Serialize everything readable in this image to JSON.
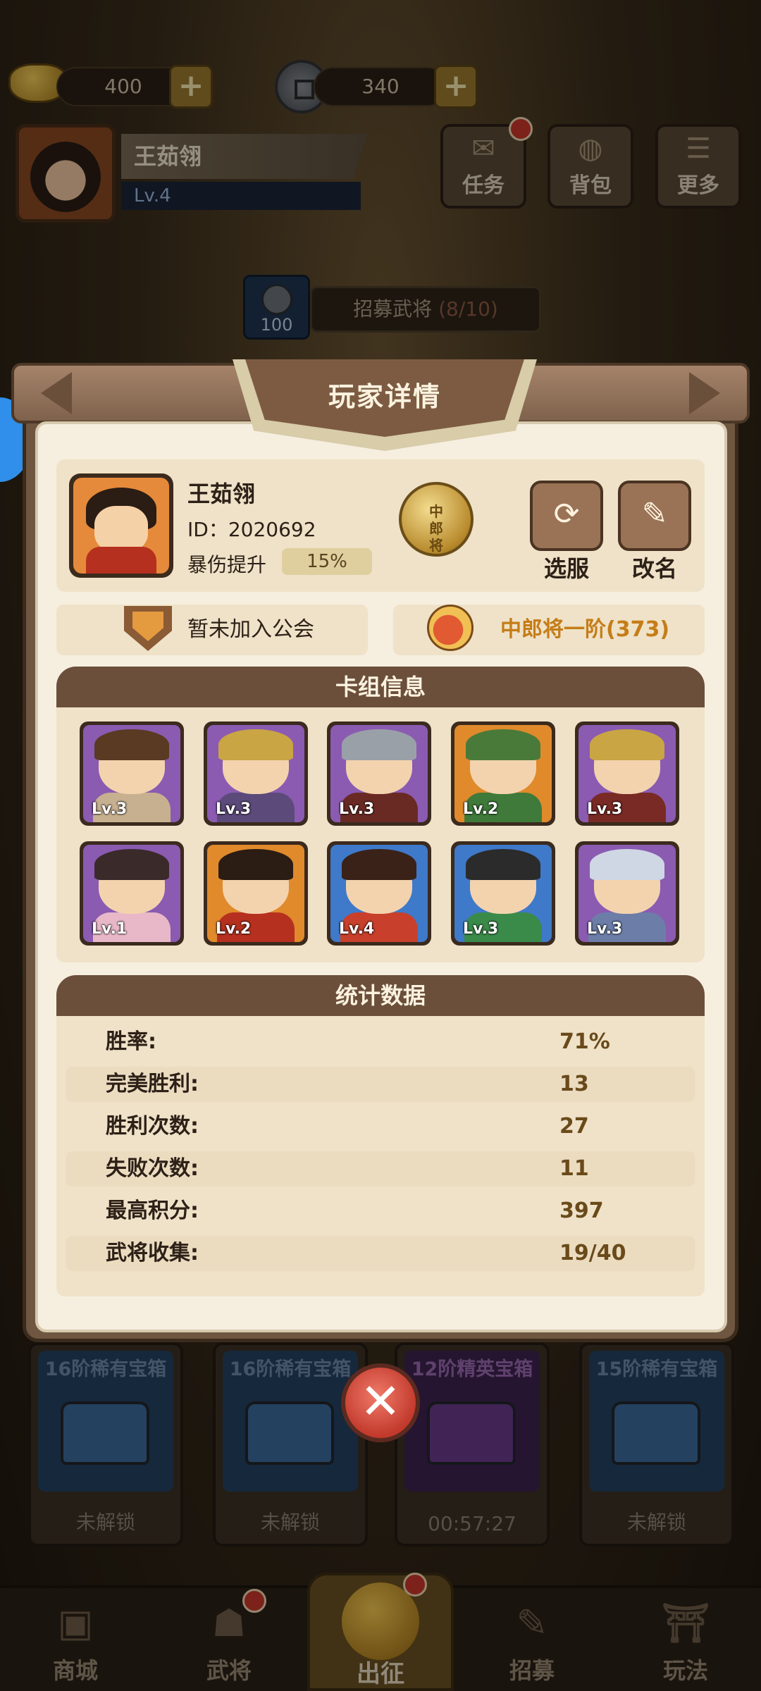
{
  "hud": {
    "gold": "400",
    "coins": "340",
    "player_name": "王茹翎",
    "player_level": "Lv.4",
    "buttons": [
      {
        "label": "任务",
        "icon": "scroll-icon"
      },
      {
        "label": "背包",
        "icon": "bag-icon"
      },
      {
        "label": "更多",
        "icon": "menu-icon"
      }
    ],
    "recruit_cost": "100",
    "recruit_label": "招募武将",
    "recruit_count": "(8/10)"
  },
  "modal": {
    "title": "玩家详情",
    "player": {
      "name": "王茹翎",
      "id": "ID：2020692",
      "crit_label": "暴伤提升",
      "crit_value": "15%",
      "rank_medal_text": "中郎将"
    },
    "actions": {
      "server_label": "选服",
      "rename_label": "改名"
    },
    "guild_label": "暂未加入公会",
    "rank_label": "中郎将一阶(373)",
    "deck_title": "卡组信息",
    "deck": [
      {
        "level": "Lv.3",
        "bg": "#8a5bb1",
        "hair": "#5a3a22",
        "body": "#c7b090"
      },
      {
        "level": "Lv.3",
        "bg": "#8a5bb1",
        "hair": "#c9a544",
        "body": "#5c4a7a"
      },
      {
        "level": "Lv.3",
        "bg": "#8a5bb1",
        "hair": "#9aa0a8",
        "body": "#6a2a24"
      },
      {
        "level": "Lv.2",
        "bg": "#e08a2c",
        "hair": "#4a7a3a",
        "body": "#3f7a3a"
      },
      {
        "level": "Lv.3",
        "bg": "#8a5bb1",
        "hair": "#c9a544",
        "body": "#7a2a24"
      },
      {
        "level": "Lv.1",
        "bg": "#8a5bb1",
        "hair": "#3a2a2a",
        "body": "#e8b8c8"
      },
      {
        "level": "Lv.2",
        "bg": "#e08a2c",
        "hair": "#2b1c14",
        "body": "#b6301f"
      },
      {
        "level": "Lv.4",
        "bg": "#3f79c9",
        "hair": "#3a2218",
        "body": "#c8402c"
      },
      {
        "level": "Lv.3",
        "bg": "#3f79c9",
        "hair": "#2b2b2b",
        "body": "#3a8a4a"
      },
      {
        "level": "Lv.3",
        "bg": "#8a5bb1",
        "hair": "#cfd6e4",
        "body": "#6c7ea8"
      }
    ],
    "stats_title": "统计数据",
    "stats": [
      {
        "label": "胜率:",
        "value": "71%"
      },
      {
        "label": "完美胜利:",
        "value": "13"
      },
      {
        "label": "胜利次数:",
        "value": "27"
      },
      {
        "label": "失败次数:",
        "value": "11"
      },
      {
        "label": "最高积分:",
        "value": "397"
      },
      {
        "label": "武将收集:",
        "value": "19/40"
      }
    ]
  },
  "chests": [
    {
      "title": "16阶稀有宝箱",
      "state": "未解锁",
      "color": "#2a5a8a"
    },
    {
      "title": "16阶稀有宝箱",
      "state": "未解锁",
      "color": "#2a5a8a"
    },
    {
      "title": "12阶精英宝箱",
      "state": "00:57:27",
      "color": "#5a2a7a"
    },
    {
      "title": "15阶稀有宝箱",
      "state": "未解锁",
      "color": "#2a5a8a"
    }
  ],
  "nav": [
    {
      "label": "商城",
      "icon": "shop-icon"
    },
    {
      "label": "武将",
      "icon": "helmet-icon"
    },
    {
      "label": "出征",
      "icon": "battle-icon"
    },
    {
      "label": "招募",
      "icon": "recruit-icon"
    },
    {
      "label": "玩法",
      "icon": "temple-icon"
    }
  ],
  "colors": {
    "accent_gold": "#d9b05a",
    "header_brown": "#6b4f3b",
    "panel_cream": "#efe2c8",
    "close_red": "#c23a2c"
  }
}
